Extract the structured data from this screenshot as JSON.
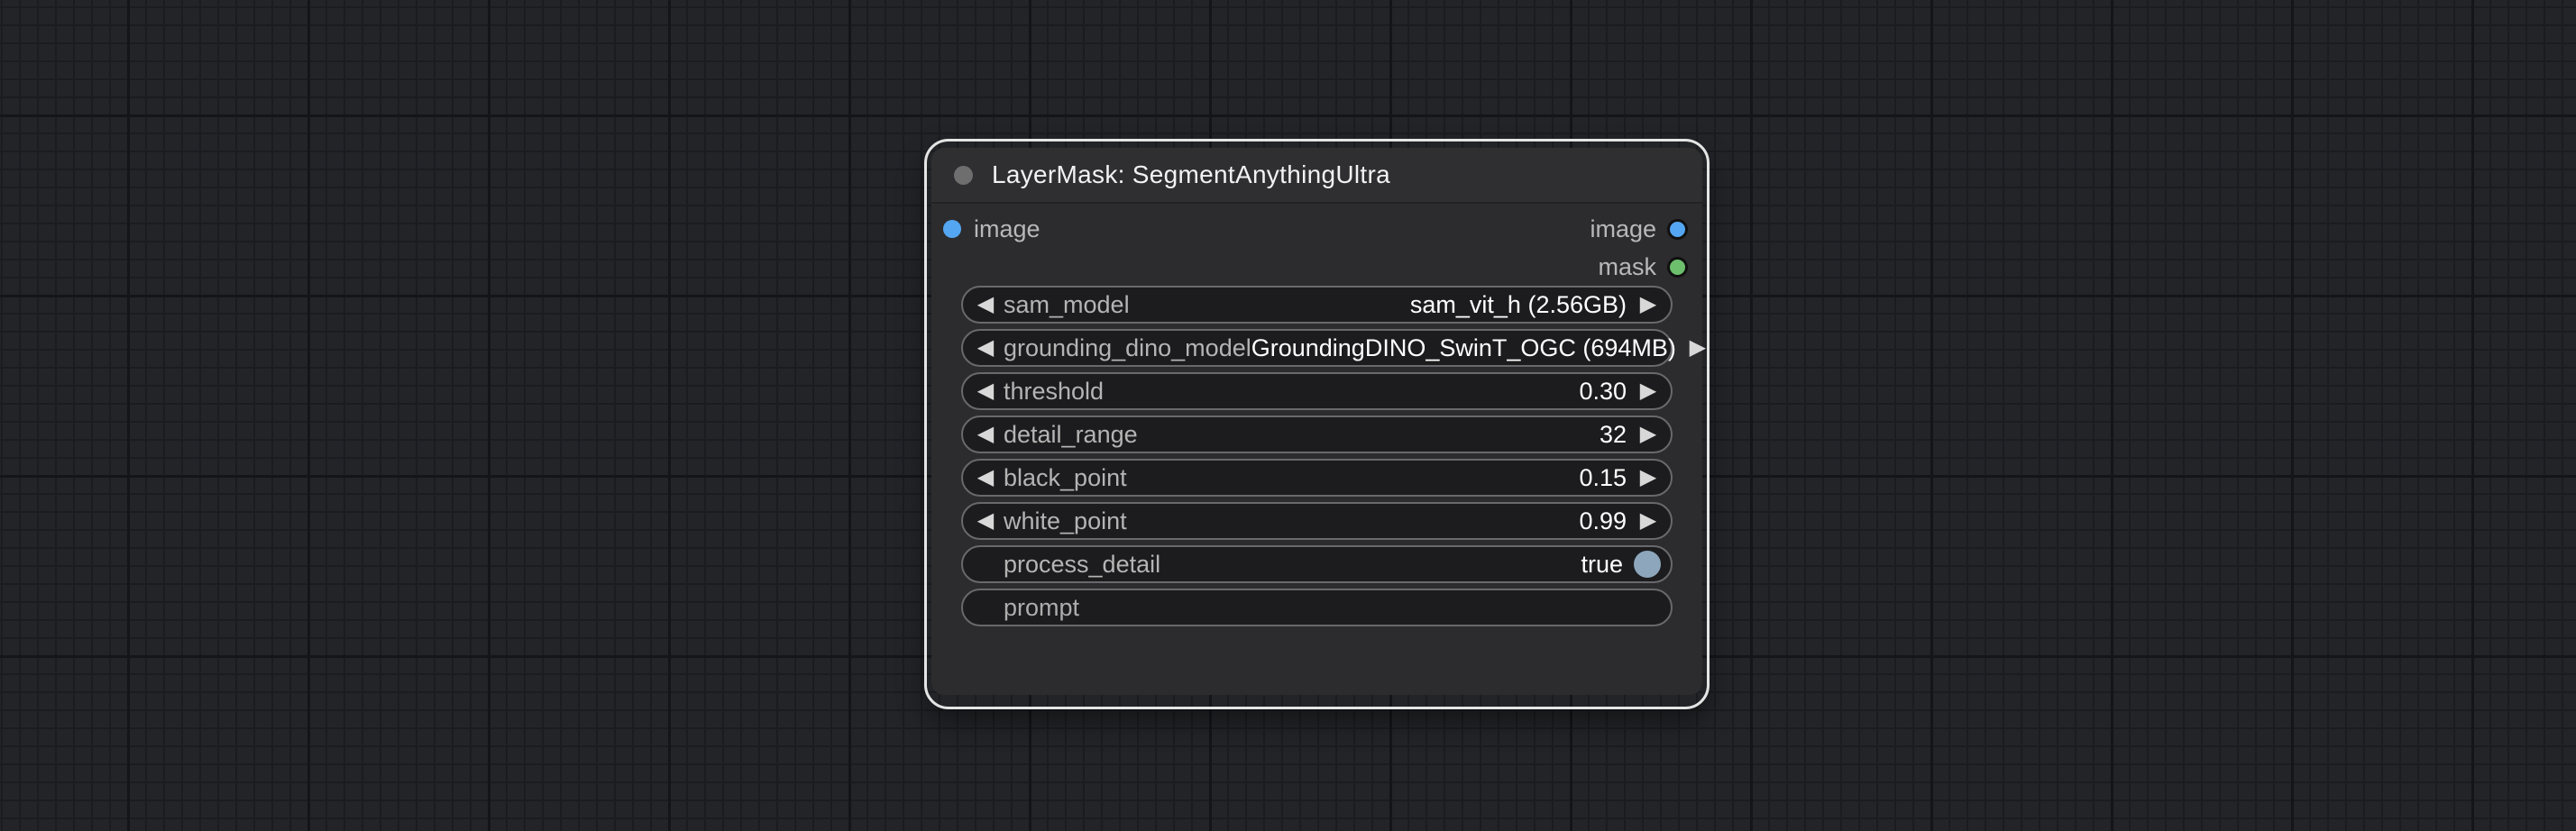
{
  "node": {
    "title": "LayerMask: SegmentAnythingUltra",
    "inputs": [
      {
        "name": "image",
        "color": "#55a6f2"
      }
    ],
    "outputs": [
      {
        "name": "image",
        "color": "#55a6f2"
      },
      {
        "name": "mask",
        "color": "#6dbf6d"
      }
    ],
    "widgets": [
      {
        "type": "combo",
        "label": "sam_model",
        "value": "sam_vit_h (2.56GB)"
      },
      {
        "type": "combo",
        "label": "grounding_dino_model",
        "value": "GroundingDINO_SwinT_OGC (694MB)"
      },
      {
        "type": "number",
        "label": "threshold",
        "value": "0.30"
      },
      {
        "type": "number",
        "label": "detail_range",
        "value": "32"
      },
      {
        "type": "number",
        "label": "black_point",
        "value": "0.15"
      },
      {
        "type": "number",
        "label": "white_point",
        "value": "0.99"
      },
      {
        "type": "toggle",
        "label": "process_detail",
        "value": "true"
      },
      {
        "type": "text",
        "label": "prompt",
        "value": ""
      }
    ]
  },
  "icons": {
    "prev": "◀",
    "next": "▶"
  },
  "colors": {
    "canvas_bg": "#232428",
    "node_bg": "#2c2c2e",
    "title_bg": "#2f2f31",
    "selection_outline": "#e4e4e4",
    "widget_bg": "#1c1c1e",
    "widget_border": "#69696d",
    "port_image": "#55a6f2",
    "port_mask": "#6dbf6d",
    "toggle_on": "#8da6bb",
    "label_text": "#b4b4b4",
    "value_text": "#ffffff"
  }
}
